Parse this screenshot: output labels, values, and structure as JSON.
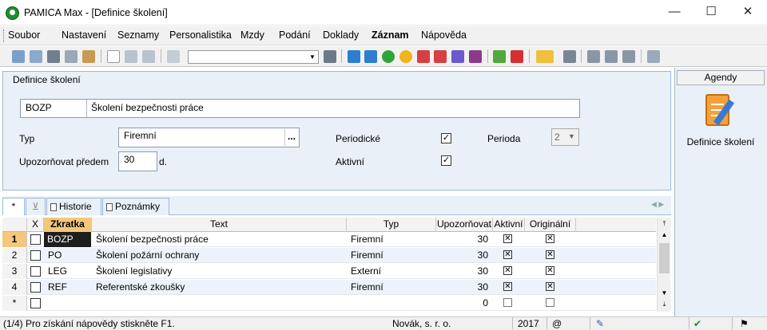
{
  "window": {
    "title": "PAMICA Max - [Definice školení]"
  },
  "menu": [
    "Soubor",
    "Nastavení",
    "Seznamy",
    "Personalistika",
    "Mzdy",
    "Podání",
    "Doklady",
    "Záznam",
    "Nápověda"
  ],
  "detail": {
    "title": "Definice školení",
    "code": "BOZP",
    "name": "Školení bezpečnosti práce",
    "typ_label": "Typ",
    "typ_value": "Firemní",
    "typ_button": "...",
    "upoz_label": "Upozorňovat předem",
    "upoz_value": "30",
    "upoz_unit": "d.",
    "periodicke_label": "Periodické",
    "periodicke_checked": true,
    "aktivni_label": "Aktivní",
    "aktivni_checked": true,
    "perioda_label": "Perioda",
    "perioda_value": "2"
  },
  "tabs": {
    "star": "*",
    "historie": "Historie",
    "poznamky": "Poznámky"
  },
  "grid": {
    "headers": {
      "x": "X",
      "zkratka": "Zkratka",
      "text": "Text",
      "typ": "Typ",
      "upoz": "Upozorňovat",
      "aktivni": "Aktivní",
      "originalni": "Originální"
    },
    "rows": [
      {
        "num": "1",
        "code": "BOZP",
        "text": "Školení bezpečnosti práce",
        "typ": "Firemní",
        "upoz": "30",
        "aktivni": true,
        "originalni": true
      },
      {
        "num": "2",
        "code": "PO",
        "text": "Školení požární ochrany",
        "typ": "Firemní",
        "upoz": "30",
        "aktivni": true,
        "originalni": true
      },
      {
        "num": "3",
        "code": "LEG",
        "text": "Školení legislativy",
        "typ": "Externí",
        "upoz": "30",
        "aktivni": true,
        "originalni": true
      },
      {
        "num": "4",
        "code": "REF",
        "text": "Referentské zkoušky",
        "typ": "Firemní",
        "upoz": "30",
        "aktivni": true,
        "originalni": true
      }
    ],
    "new_row": {
      "num": "*",
      "upoz": "0"
    }
  },
  "agendy": {
    "header": "Agendy",
    "item": "Definice školení"
  },
  "status": {
    "help": "(1/4) Pro získání nápovědy stiskněte F1.",
    "company": "Novák, s. r. o.",
    "year": "2017",
    "at": "@"
  }
}
